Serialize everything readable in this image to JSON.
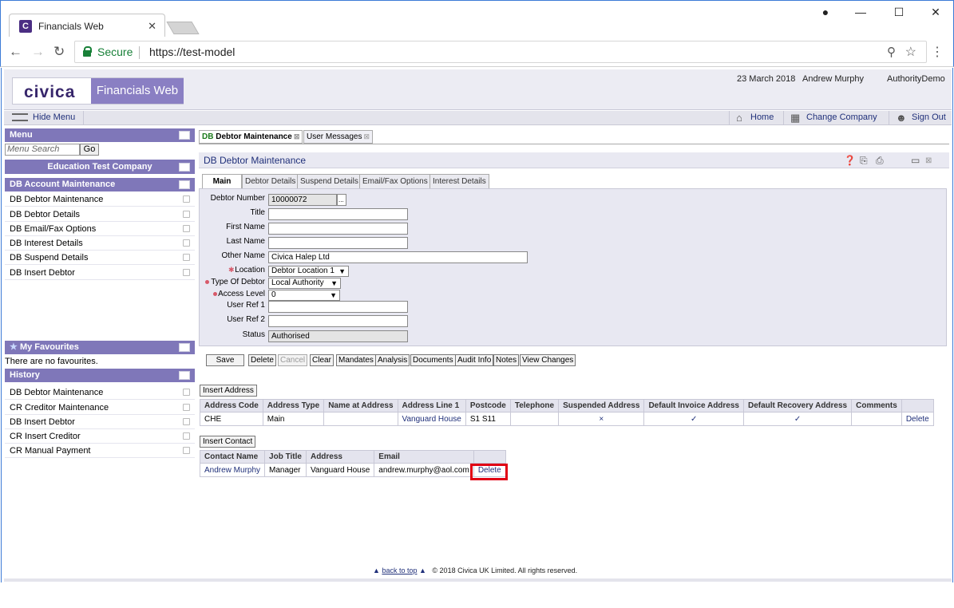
{
  "browser": {
    "tab_title": "Financials Web",
    "tab_favicon": "C",
    "secure_label": "Secure",
    "url": "https://test-model"
  },
  "app": {
    "logo_text": "civica",
    "product_name": "Financials Web",
    "date": "23 March 2018",
    "user": "Andrew Murphy",
    "company_code": "AuthorityDemo"
  },
  "toolbar": {
    "hide_menu": "Hide Menu",
    "home": "Home",
    "change_company": "Change Company",
    "sign_out": "Sign Out"
  },
  "sidebar": {
    "menu_title": "Menu",
    "search_placeholder": "Menu Search",
    "go_label": "Go",
    "company": "Education Test Company",
    "section_title": "DB Account Maintenance",
    "items": [
      "DB Debtor Maintenance",
      "DB Debtor Details",
      "DB Email/Fax Options",
      "DB Interest Details",
      "DB Suspend Details",
      "DB Insert Debtor"
    ],
    "favourites_title": "My Favourites",
    "favourites_empty": "There are no favourites.",
    "history_title": "History",
    "history": [
      "DB Debtor Maintenance",
      "CR Creditor Maintenance",
      "DB Insert Debtor",
      "CR Insert Creditor",
      "CR Manual Payment"
    ]
  },
  "main": {
    "tabs": [
      {
        "prefix": "DB",
        "label": "Debtor Maintenance"
      },
      {
        "label": "User Messages"
      }
    ],
    "panel_title": "DB Debtor Maintenance",
    "form_tabs": [
      "Main",
      "Debtor Details",
      "Suspend Details",
      "Email/Fax Options",
      "Interest Details"
    ],
    "fields": {
      "debtor_number_label": "Debtor Number",
      "debtor_number": "10000072",
      "title_label": "Title",
      "first_name_label": "First Name",
      "last_name_label": "Last Name",
      "other_name_label": "Other Name",
      "other_name": "Civica Halep Ltd",
      "location_label": "Location",
      "location": "Debtor Location 1",
      "type_label": "Type Of Debtor",
      "type": "Local Authority",
      "access_label": "Access Level",
      "access": "0",
      "user_ref1_label": "User Ref 1",
      "user_ref2_label": "User Ref 2",
      "status_label": "Status",
      "status": "Authorised",
      "lookup": "..."
    },
    "buttons": [
      "Save",
      "Delete",
      "Cancel",
      "Clear",
      "Mandates",
      "Analysis",
      "Documents",
      "Audit Info",
      "Notes",
      "View Changes"
    ],
    "insert_address": "Insert Address",
    "address_headers": [
      "Address Code",
      "Address Type",
      "Name at Address",
      "Address Line 1",
      "Postcode",
      "Telephone",
      "Suspended Address",
      "Default Invoice Address",
      "Default Recovery Address",
      "Comments",
      ""
    ],
    "address_rows": [
      {
        "code": "CHE",
        "type": "Main",
        "name": "",
        "line1": "Vanguard House",
        "postcode": "S1 S11",
        "phone": "",
        "suspended": "×",
        "invoice": "✓",
        "recovery": "✓",
        "comments": "",
        "action": "Delete"
      }
    ],
    "insert_contact": "Insert Contact",
    "contact_headers": [
      "Contact Name",
      "Job Title",
      "Address",
      "Email",
      ""
    ],
    "contact_rows": [
      {
        "name": "Andrew Murphy",
        "job": "Manager",
        "address": "Vanguard House",
        "email": "andrew.murphy@aol.com",
        "action": "Delete"
      }
    ]
  },
  "footer": {
    "back_to_top": "back to top",
    "copyright": "© 2018 Civica UK Limited. All rights reserved."
  },
  "colors": {
    "header_purple": "#7f77b9",
    "link_blue": "#20307a",
    "highlight_red": "#e00014"
  }
}
